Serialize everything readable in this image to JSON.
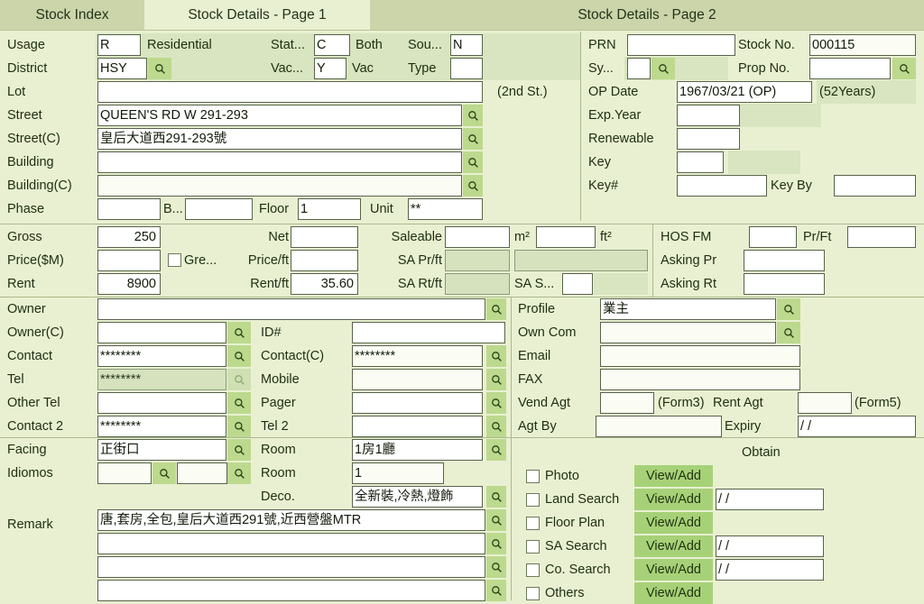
{
  "tabs": [
    {
      "label": "Stock Index",
      "active": false
    },
    {
      "label": "Stock Details - Page 1",
      "active": true
    },
    {
      "label": "Stock Details - Page 2",
      "active": false
    }
  ],
  "left_top": {
    "usage_label": "Usage",
    "usage_code": "R",
    "usage_text": "Residential",
    "status_label": "Stat...",
    "status_code": "C",
    "status_text": "Both",
    "source_label": "Sou...",
    "source_code": "N",
    "district_label": "District",
    "district_code": "HSY",
    "vacant_label": "Vac...",
    "vacant_code": "Y",
    "vacant_text": "Vac",
    "type_label": "Type",
    "type_code": "",
    "lot_label": "Lot",
    "lot_value": "",
    "second_st": "(2nd St.)",
    "street_label": "Street",
    "street_value": "QUEEN'S RD W 291-293",
    "street_c_label": "Street(C)",
    "street_c_value": "皇后大道西291-293號",
    "building_label": "Building",
    "building_value": "",
    "building_c_label": "Building(C)",
    "building_c_value": "",
    "phase_label": "Phase",
    "phase_value": "",
    "block_label": "B...",
    "block_value": "",
    "floor_label": "Floor",
    "floor_value": "1",
    "unit_label": "Unit",
    "unit_value": "**"
  },
  "right_top": {
    "prn_label": "PRN",
    "prn_value": "",
    "stock_no_label": "Stock No.",
    "stock_no_value": "000115",
    "sys_label": "Sy...",
    "sys_value": "",
    "prop_no_label": "Prop No.",
    "prop_no_value": "",
    "op_date_label": "OP Date",
    "op_date_value": "1967/03/21 (OP)",
    "op_age": "(52Years)",
    "exp_year_label": "Exp.Year",
    "exp_year_value": "",
    "renewable_label": "Renewable",
    "renewable_value": "",
    "key_label": "Key",
    "key_value": "",
    "key_no_label": "Key#",
    "key_no_value": "",
    "key_by_label": "Key By",
    "key_by_value": ""
  },
  "area_price": {
    "gross_label": "Gross",
    "gross_value": "250",
    "net_label": "Net",
    "net_value": "",
    "saleable_label": "Saleable",
    "saleable_value": "",
    "m2_label": "m²",
    "m2_value": "",
    "ft2_label": "ft²",
    "hos_fm_label": "HOS FM",
    "hos_fm_value": "",
    "pr_ft_label": "Pr/Ft",
    "pr_ft_value": "",
    "price_label": "Price($M)",
    "price_value": "",
    "green_label": "Gre...",
    "price_ft_label": "Price/ft",
    "price_ft_value": "",
    "sa_pr_ft_label": "SA Pr/ft",
    "sa_pr_ft_value": "",
    "sa_pr_ft_value2": "",
    "asking_pr_label": "Asking Pr",
    "asking_pr_value": "",
    "rent_label": "Rent",
    "rent_value": "8900",
    "rent_ft_label": "Rent/ft",
    "rent_ft_value": "35.60",
    "sa_rt_ft_label": "SA Rt/ft",
    "sa_rt_ft_value": "",
    "sa_s_label": "SA S...",
    "sa_s_value": "",
    "asking_rt_label": "Asking Rt",
    "asking_rt_value": ""
  },
  "contacts": {
    "owner_label": "Owner",
    "owner_value": "",
    "owner_c_label": "Owner(C)",
    "owner_c_value": "",
    "id_label": "ID#",
    "id_value": "",
    "contact_label": "Contact",
    "contact_value": "********",
    "contact_c_label": "Contact(C)",
    "contact_c_value": "********",
    "tel_label": "Tel",
    "tel_value": "********",
    "mobile_label": "Mobile",
    "mobile_value": "",
    "other_tel_label": "Other Tel",
    "other_tel_value": "",
    "pager_label": "Pager",
    "pager_value": "",
    "contact2_label": "Contact 2",
    "contact2_value": "********",
    "tel2_label": "Tel 2",
    "tel2_value": ""
  },
  "profile": {
    "profile_label": "Profile",
    "profile_value": "業主",
    "own_com_label": "Own Com",
    "own_com_value": "",
    "email_label": "Email",
    "email_value": "",
    "fax_label": "FAX",
    "fax_value": "",
    "vend_agt_label": "Vend Agt",
    "vend_agt_value": "",
    "form3_label": "(Form3)",
    "rent_agt_label": "Rent Agt",
    "rent_agt_value": "",
    "form5_label": "(Form5)",
    "agt_by_label": "Agt By",
    "agt_by_value": "",
    "expiry_label": "Expiry",
    "expiry_value": "/ /"
  },
  "detail": {
    "facing_label": "Facing",
    "facing_value": "正街口",
    "room_label": "Room",
    "room_value": "1房1廳",
    "idiomos_label": "Idiomos",
    "idiomos_value1": "",
    "idiomos_value2": "",
    "room2_label": "Room",
    "room2_value": "1",
    "deco_label": "Deco.",
    "deco_value": "全新裝,冷熱,燈飾",
    "remark_label": "Remark",
    "remark_lines": [
      "唐,套房,全包,皇后大道西291號,近西營盤MTR",
      "",
      "",
      ""
    ]
  },
  "obtain": {
    "title": "Obtain",
    "button_label": "View/Add",
    "rows": [
      {
        "label": "Photo",
        "checked": false,
        "has_date": false,
        "date": ""
      },
      {
        "label": "Land Search",
        "checked": false,
        "has_date": true,
        "date": "/ /"
      },
      {
        "label": "Floor Plan",
        "checked": false,
        "has_date": false,
        "date": ""
      },
      {
        "label": "SA Search",
        "checked": false,
        "has_date": true,
        "date": "/ /"
      },
      {
        "label": "Co. Search",
        "checked": false,
        "has_date": true,
        "date": "/ /"
      },
      {
        "label": "Others",
        "checked": false,
        "has_date": false,
        "date": ""
      }
    ]
  },
  "icons": {
    "search": "search-icon"
  },
  "colors": {
    "tabbar_bg": "#ccd5aa",
    "body_bg": "#e9f0d2",
    "search_btn": "#bcd98d",
    "action_btn": "#a7d178",
    "shade": "#d8e5c0",
    "text": "#1d2e10"
  }
}
